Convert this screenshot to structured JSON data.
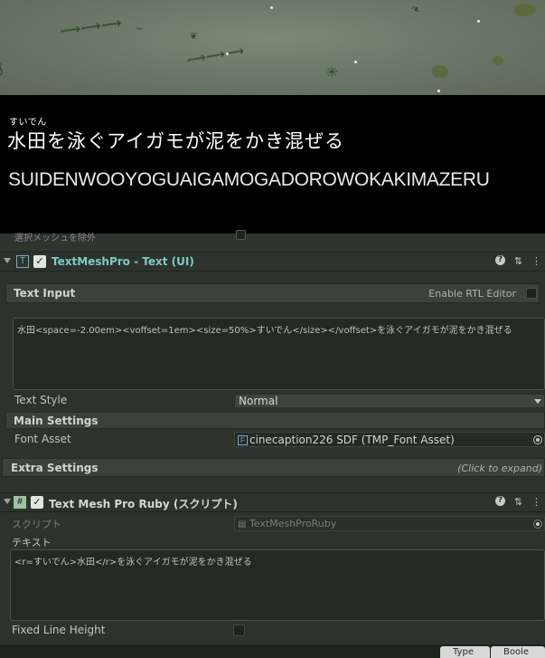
{
  "preview": {
    "ruby_text": "すいでん",
    "japanese_text": "水田を泳ぐアイガモが泥をかき混ぜる",
    "romaji_text": "SUIDENWOOYOGUAIGAMOGADOROWOKAKIMAZERU"
  },
  "cut_row": {
    "label": "選択メッシュを除外"
  },
  "tmp_component": {
    "title": "TextMeshPro - Text (UI)",
    "icon_letter": "T",
    "text_input_label": "Text Input",
    "enable_rtl_label": "Enable RTL Editor",
    "input_value": "水田<space=-2.00em><voffset=1em><size=50%>すいでん</size></voffset>を泳ぐアイガモが泥をかき混ぜる",
    "text_style_label": "Text Style",
    "text_style_value": "Normal",
    "main_settings_label": "Main Settings",
    "font_asset_label": "Font Asset",
    "font_asset_value": "cinecaption226 SDF (TMP_Font Asset)",
    "font_icon_letter": "F",
    "extra_settings_label": "Extra Settings",
    "extra_settings_hint": "(Click to expand)"
  },
  "ruby_component": {
    "title": "Text Mesh Pro Ruby (スクリプト)",
    "script_label": "スクリプト",
    "script_value": "TextMeshProRuby",
    "text_label": "テキスト",
    "text_value": "<r=すいでん>水田</r>を泳ぐアイガモが泥をかき混ぜる",
    "fixed_line_height_label": "Fixed Line Height"
  },
  "header_icons": {
    "help": "?",
    "settings": "⇅",
    "more": "⋮"
  },
  "bottom_strip": {
    "type_label": "Type",
    "bool_label": "Boole"
  }
}
